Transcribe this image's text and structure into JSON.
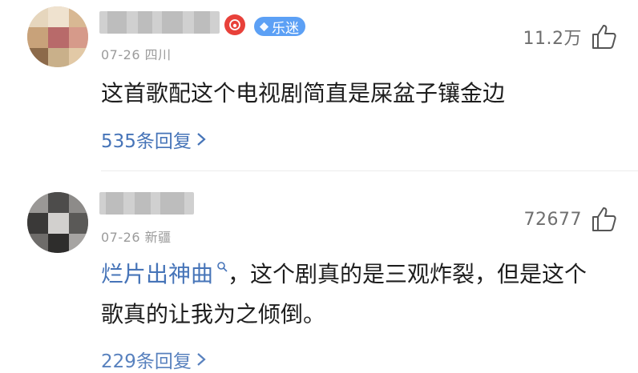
{
  "comments": [
    {
      "date": "07-26",
      "region": "四川",
      "level_badge": "乐迷",
      "likes": "11.2万",
      "text": "这首歌配这个电视剧简直是屎盆子镶金边",
      "replies": "535条回复"
    },
    {
      "date": "07-26",
      "region": "新疆",
      "likes": "72677",
      "tag": "烂片出神曲",
      "text_rest": "，这个剧真的是三观炸裂，但是这个歌真的让我为之倾倒。",
      "replies": "229条回复"
    }
  ],
  "colors": {
    "link": "#4674b8",
    "badge": "#5ca0f5",
    "music_red": "#e8413a"
  },
  "icons": [
    "thumbs-up-icon",
    "music-note-icon",
    "gem-icon",
    "search-icon",
    "chevron-right-icon"
  ]
}
